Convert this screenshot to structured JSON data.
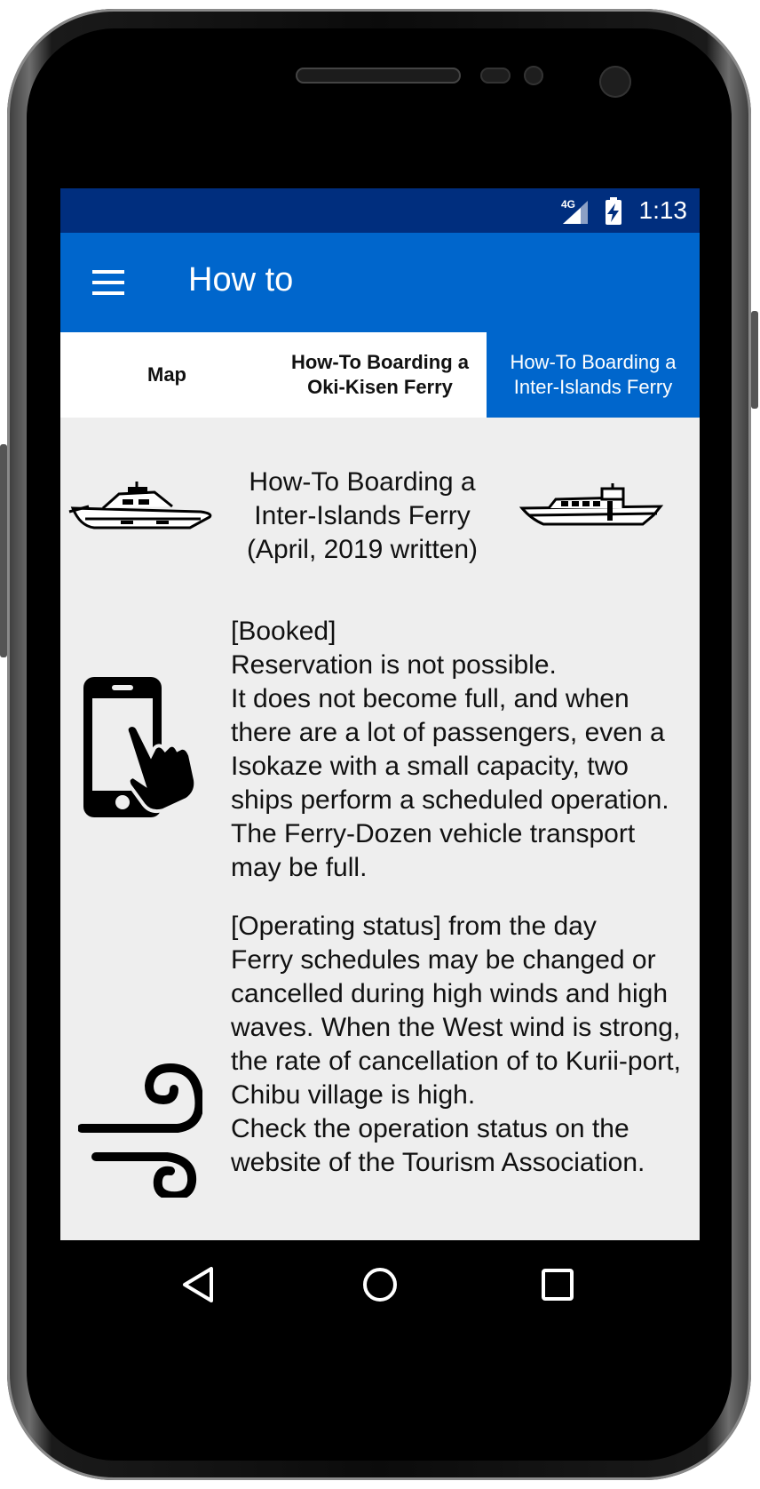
{
  "status_bar": {
    "network": "4G",
    "time": "1:13",
    "icons": [
      "signal-icon",
      "battery-charging-icon"
    ]
  },
  "app_bar": {
    "title": "How to",
    "menu_icon": "hamburger-menu-icon"
  },
  "tabs": [
    {
      "label": "Map",
      "active": false
    },
    {
      "label": "How-To Boarding a Oki-Kisen Ferry",
      "active": false
    },
    {
      "label": "How-To Boarding a Inter-Islands Ferry",
      "active": true
    }
  ],
  "colors": {
    "status_bar": "#002e7e",
    "app_bar": "#0066cc",
    "active_tab": "#0066cc",
    "content_bg": "#eeeeee"
  },
  "content": {
    "heading": "How-To Boarding a Inter-Islands Ferry (April, 2019 written)",
    "sections": [
      {
        "icon": "smartphone-touch-icon",
        "text": "[Booked]\nReservation is not possible.\nIt does not become full, and when there are a lot of passengers, even a Isokaze with a small capacity, two ships perform a scheduled operation.\nThe Ferry-Dozen vehicle transport may be full."
      },
      {
        "icon": "wind-icon",
        "text": "[Operating status] from the day\nFerry schedules may be changed or cancelled during high winds and high waves. When the West wind is strong, the rate of cancellation of to Kurii-port, Chibu village is high.\nCheck the operation status on the website of the Tourism Association."
      }
    ]
  },
  "nav_bar": {
    "buttons": [
      "back-icon",
      "home-icon",
      "recents-icon"
    ]
  }
}
